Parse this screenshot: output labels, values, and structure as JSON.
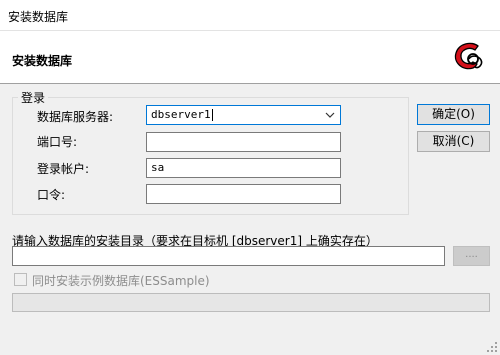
{
  "window": {
    "title": "安装数据库"
  },
  "header": {
    "title": "安装数据库",
    "logo_icon": "red-c-logo-icon"
  },
  "login_group": {
    "legend": "登录",
    "server_label": "数据库服务器:",
    "server_value": "dbserver1",
    "port_label": "端口号:",
    "port_value": "",
    "account_label": "登录帐户:",
    "account_value": "sa",
    "password_label": "口令:",
    "password_value": ""
  },
  "buttons": {
    "ok": "确定(O)",
    "cancel": "取消(C)",
    "browse": "...."
  },
  "install_dir": {
    "label": "请输入数据库的安装目录（要求在目标机 [dbserver1] 上确实存在）",
    "value": ""
  },
  "sample": {
    "label": "同时安装示例数据库(ESSample)",
    "checked": false,
    "enabled": false
  },
  "progress": {
    "value": 0
  },
  "colors": {
    "accent": "#0078d7",
    "logo_red": "#d4101a"
  }
}
